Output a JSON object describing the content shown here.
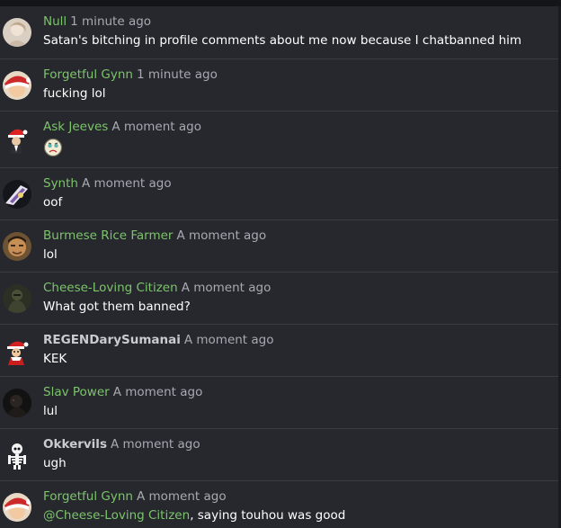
{
  "messages": [
    {
      "user": "Null",
      "time": "1 minute ago",
      "text": "Satan's bitching in profile comments about me now because I chatbanned him",
      "avatar": "portrait-avatar-icon"
    },
    {
      "user": "Forgetful Gynn",
      "time": "1 minute ago",
      "text": "fucking lol",
      "avatar": "santa-hat-avatar-icon"
    },
    {
      "user": "Ask Jeeves",
      "time": "A moment ago",
      "emoji": "worried-face-emoji",
      "avatar": "butler-santa-avatar-icon"
    },
    {
      "user": "Synth",
      "time": "A moment ago",
      "text": "oof",
      "avatar": "abstract-avatar-icon"
    },
    {
      "user": "Burmese Rice Farmer",
      "time": "A moment ago",
      "text": "lol",
      "avatar": "face-photo-avatar-icon"
    },
    {
      "user": "Cheese-Loving Citizen",
      "time": "A moment ago",
      "text": "What got them banned?",
      "avatar": "dark-figure-avatar-icon"
    },
    {
      "user": "REGENDarySumanai",
      "time": "A moment ago",
      "text": "KEK",
      "avatar": "santa-character-avatar-icon"
    },
    {
      "user": "Slav Power",
      "time": "A moment ago",
      "text": "lul",
      "avatar": "dark-photo-avatar-icon"
    },
    {
      "user": "Okkervils",
      "time": "A moment ago",
      "text": "ugh",
      "avatar": "skeleton-avatar-icon"
    },
    {
      "user": "Forgetful Gynn",
      "time": "A moment ago",
      "mention": "@Cheese-Loving Citizen",
      "text": ", saying touhou was good",
      "avatar": "santa-hat-avatar-icon"
    }
  ],
  "colors": {
    "background": "#26282e",
    "username": "#7cc46a",
    "bold_username": "#c9cbd0",
    "timestamp": "#a7aab1",
    "message_text": "#ffffff",
    "divider": "#3a3c43"
  }
}
